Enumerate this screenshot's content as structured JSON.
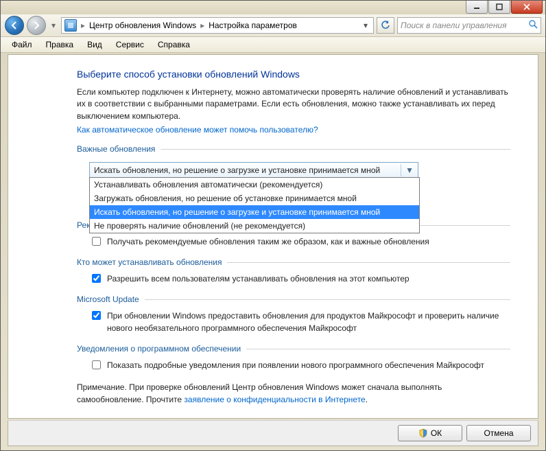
{
  "titlebar": {
    "min_tip": "Свернуть",
    "max_tip": "Развернуть",
    "close_tip": "Закрыть"
  },
  "nav": {
    "crumb1": "Центр обновления Windows",
    "crumb2": "Настройка параметров",
    "search_placeholder": "Поиск в панели управления"
  },
  "menu": {
    "file": "Файл",
    "edit": "Правка",
    "view": "Вид",
    "tools": "Сервис",
    "help": "Справка"
  },
  "page": {
    "title": "Выберите способ установки обновлений Windows",
    "intro": "Если компьютер подключен к Интернету, можно автоматически проверять наличие обновлений и устанавливать их в соответствии с выбранными параметрами. Если есть обновления, можно также устанавливать их перед выключением компьютера.",
    "help_link": "Как автоматическое обновление может помочь пользователю?"
  },
  "sections": {
    "important": {
      "legend": "Важные обновления",
      "selected": "Искать обновления, но решение о загрузке и установке принимается мной",
      "options": [
        "Устанавливать обновления автоматически (рекомендуется)",
        "Загружать обновления, но решение об установке принимается мной",
        "Искать обновления, но решение о загрузке и установке принимается мной",
        "Не проверять наличие обновлений (не рекомендуется)"
      ],
      "selected_index": 2
    },
    "recommended": {
      "legend": "Реко",
      "check_label": "Получать рекомендуемые обновления таким же образом, как и важные обновления"
    },
    "who": {
      "legend": "Кто может устанавливать обновления",
      "check_label": "Разрешить всем пользователям устанавливать обновления на этот компьютер"
    },
    "msupdate": {
      "legend": "Microsoft Update",
      "check_label": "При обновлении Windows предоставить обновления для продуктов Майкрософт и проверить наличие нового необязательного программного обеспечения Майкрософт"
    },
    "notify": {
      "legend": "Уведомления о программном обеспечении",
      "check_label": "Показать подробные уведомления при появлении нового программного обеспечения Майкрософт"
    }
  },
  "note": {
    "prefix": "Примечание. При проверке обновлений Центр обновления Windows может сначала выполнять самообновление. Прочтите ",
    "link": "заявление о конфиденциальности в Интернете",
    "suffix": "."
  },
  "footer": {
    "ok": "ОК",
    "cancel": "Отмена"
  }
}
